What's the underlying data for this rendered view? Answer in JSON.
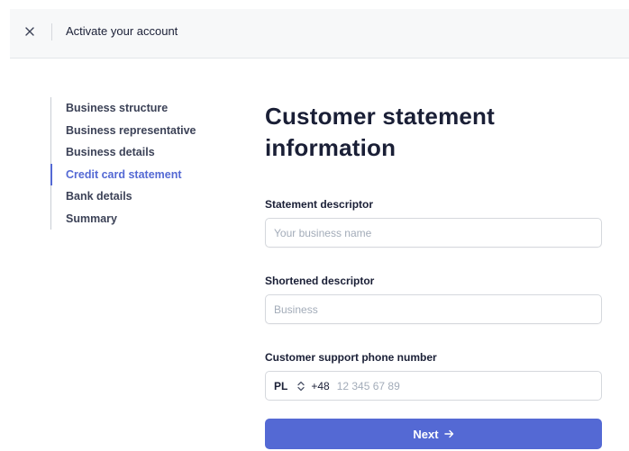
{
  "header": {
    "title": "Activate your account",
    "close_icon": "close-icon"
  },
  "steps": [
    {
      "label": "Business structure",
      "active": false
    },
    {
      "label": "Business representative",
      "active": false
    },
    {
      "label": "Business details",
      "active": false
    },
    {
      "label": "Credit card statement",
      "active": true
    },
    {
      "label": "Bank details",
      "active": false
    },
    {
      "label": "Summary",
      "active": false
    }
  ],
  "main": {
    "heading": "Customer statement information",
    "statement_descriptor": {
      "label": "Statement descriptor",
      "value": "",
      "placeholder": "Your business name"
    },
    "shortened_descriptor": {
      "label": "Shortened descriptor",
      "value": "",
      "placeholder": "Business"
    },
    "support_phone": {
      "label": "Customer support phone number",
      "country": "PL",
      "dial_code": "+48",
      "value": "",
      "placeholder": "12 345 67 89"
    },
    "next_button": {
      "label": "Next",
      "icon": "arrow-right-icon"
    }
  },
  "colors": {
    "accent": "#5469d4",
    "topbar_bg": "#f7f8f9",
    "text": "#1a1f36"
  }
}
